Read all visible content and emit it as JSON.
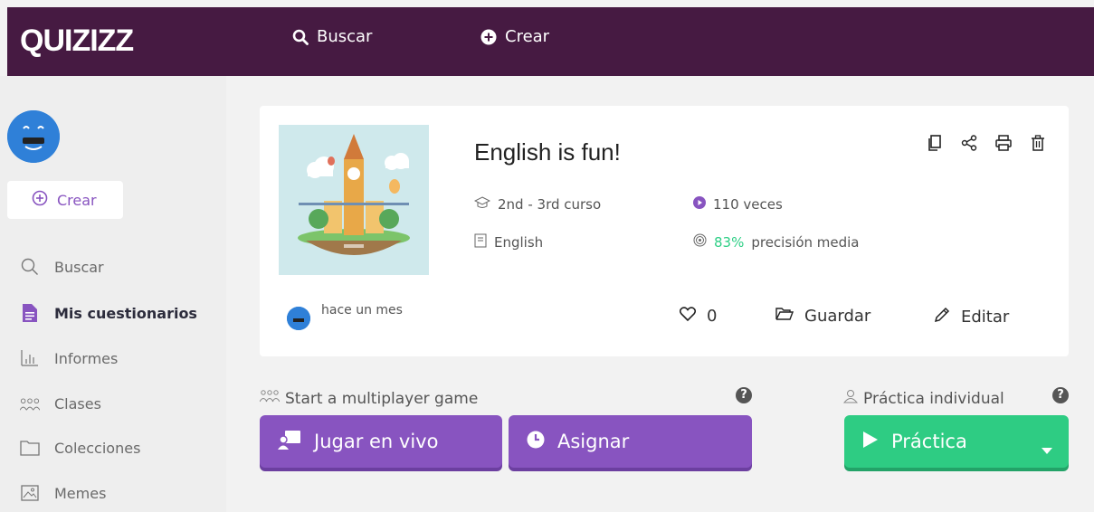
{
  "header": {
    "logo": "QUIZIZZ",
    "nav": [
      {
        "label": "Buscar",
        "icon": "search-icon"
      },
      {
        "label": "Crear",
        "icon": "plus-circle-icon"
      }
    ]
  },
  "sidebar": {
    "create_label": "Crear",
    "items": [
      {
        "label": "Buscar",
        "icon": "search-icon"
      },
      {
        "label": "Mis cuestionarios",
        "icon": "document-icon",
        "active": true
      },
      {
        "label": "Informes",
        "icon": "bar-chart-icon"
      },
      {
        "label": "Clases",
        "icon": "users-icon"
      },
      {
        "label": "Colecciones",
        "icon": "folder-icon"
      },
      {
        "label": "Memes",
        "icon": "image-icon"
      }
    ]
  },
  "quiz": {
    "title": "English is fun!",
    "grade": "2nd - 3rd curso",
    "subject": "English",
    "plays": "110 veces",
    "accuracy_value": "83%",
    "accuracy_label": "precisión media",
    "author_time": "hace un mes",
    "likes": "0",
    "save_label": "Guardar",
    "edit_label": "Editar",
    "tools": [
      "copy-icon",
      "share-icon",
      "print-icon",
      "delete-icon"
    ]
  },
  "multiplayer": {
    "heading": "Start a multiplayer game",
    "live_label": "Jugar en vivo",
    "assign_label": "Asignar"
  },
  "practice": {
    "heading": "Práctica individual",
    "button_label": "Práctica"
  },
  "colors": {
    "header_bg": "#461a42",
    "accent_purple": "#8854c0",
    "accent_green": "#2ecc83",
    "accuracy_green": "#2fcf86"
  }
}
